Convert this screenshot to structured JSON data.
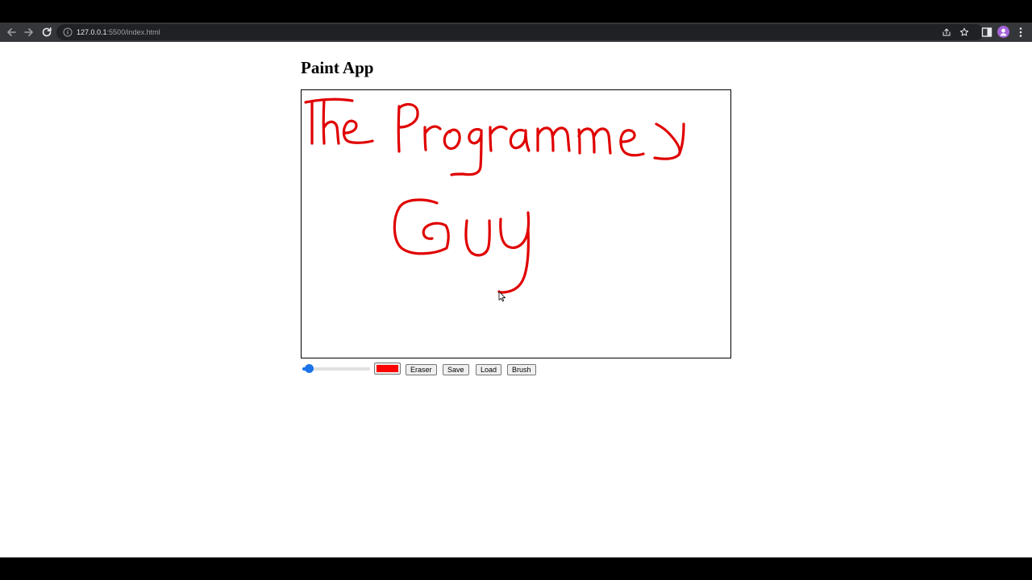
{
  "browser": {
    "url_host": "127.0.0.1",
    "url_rest": ":5500/index.html",
    "icons": [
      "back-arrow-icon",
      "forward-arrow-icon",
      "reload-icon",
      "info-icon",
      "share-icon",
      "star-icon",
      "side-panel-icon",
      "profile-icon",
      "kebab-menu-icon"
    ],
    "avatar_color": "#a463d8"
  },
  "page": {
    "title": "Paint App"
  },
  "canvas": {
    "stroke_color": "#e00000",
    "drawn_text": "The Programmer Guy"
  },
  "controls": {
    "brush_size": {
      "value": 10,
      "min": 1,
      "max": 100
    },
    "color_value": "#ff0000",
    "buttons": {
      "eraser": "Eraser",
      "save": "Save",
      "load": "Load",
      "brush": "Brush"
    }
  }
}
